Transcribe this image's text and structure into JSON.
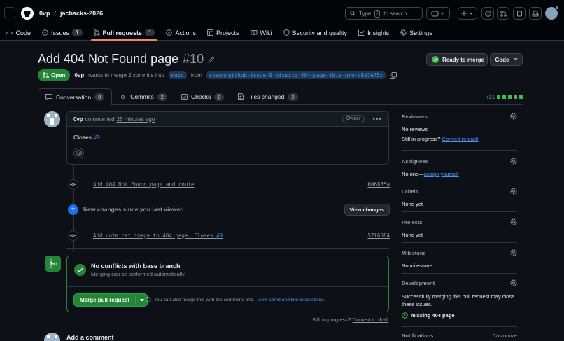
{
  "header": {
    "owner": "0vp",
    "separator": "/",
    "repo": "jachacks-2026",
    "search": {
      "prefix": "Type",
      "key": "/",
      "suffix": "to search"
    }
  },
  "nav": [
    {
      "label": "Code",
      "icon": "code-icon",
      "count": ""
    },
    {
      "label": "Issues",
      "icon": "issue-icon",
      "count": "1"
    },
    {
      "label": "Pull requests",
      "icon": "pull-request-icon",
      "count": "1",
      "active": true
    },
    {
      "label": "Actions",
      "icon": "play-icon",
      "count": ""
    },
    {
      "label": "Projects",
      "icon": "table-icon",
      "count": ""
    },
    {
      "label": "Wiki",
      "icon": "book-icon",
      "count": ""
    },
    {
      "label": "Security and quality",
      "icon": "shield-icon",
      "count": ""
    },
    {
      "label": "Insights",
      "icon": "graph-icon",
      "count": ""
    },
    {
      "label": "Settings",
      "icon": "gear-icon",
      "count": ""
    }
  ],
  "pr": {
    "title": "Add 404 Not Found page",
    "number": "#10",
    "ready_label": "Ready to merge",
    "code_label": "Code",
    "state": "Open",
    "author": "0vp",
    "summary": "wants to merge 2 commits into",
    "base": "main",
    "from_word": "from",
    "head": "spawn/github-issue-9-missing-404-page-this-pro-c8e7e75c"
  },
  "tabs": [
    {
      "label": "Conversation",
      "count": "0",
      "icon": "comment-icon",
      "active": true
    },
    {
      "label": "Commits",
      "count": "2",
      "icon": "commit-icon"
    },
    {
      "label": "Checks",
      "count": "0",
      "icon": "checks-icon"
    },
    {
      "label": "Files changed",
      "count": "2",
      "icon": "file-diff-icon"
    }
  ],
  "diffstat": "+21",
  "comment": {
    "author": "0vp",
    "action": "commented",
    "time": "25 minutes ago",
    "role": "Owner",
    "body_text": "Closes",
    "body_ref": "#9"
  },
  "commits": [
    {
      "message": "Add 404 Not Found page and route",
      "ref": "",
      "sha": "606835a"
    },
    {
      "message": "Add cute cat image to 404 page. Closes",
      "ref": "#9",
      "sha": "57f6384"
    }
  ],
  "new_changes": {
    "label": "New changes since you last viewed",
    "button": "View changes"
  },
  "merge": {
    "title": "No conflicts with base branch",
    "subtitle": "Merging can be performed automatically.",
    "button": "Merge pull request",
    "hint": "You can also merge this with the command line.",
    "hint_link": "View command line instructions."
  },
  "still_progress": {
    "text": "Still in progress?",
    "link": "Convert to draft"
  },
  "add_comment": "Add a comment",
  "sidebar": {
    "reviewers": {
      "title": "Reviewers",
      "value": "No reviews",
      "note": "Still in progress?",
      "note_link": "Convert to draft"
    },
    "assignees": {
      "title": "Assignees",
      "value": "No one—",
      "link": "assign yourself"
    },
    "labels": {
      "title": "Labels",
      "value": "None yet"
    },
    "projects": {
      "title": "Projects",
      "value": "None yet"
    },
    "milestone": {
      "title": "Milestone",
      "value": "No milestone"
    },
    "development": {
      "title": "Development",
      "value": "Successfully merging this pull request may close these issues.",
      "issue": "missing 404 page"
    },
    "notifications": {
      "title": "Notifications",
      "action": "Customize"
    }
  },
  "colors": {
    "accent": "#4493f8",
    "success": "#238636",
    "tab_underline": "#f78166"
  }
}
